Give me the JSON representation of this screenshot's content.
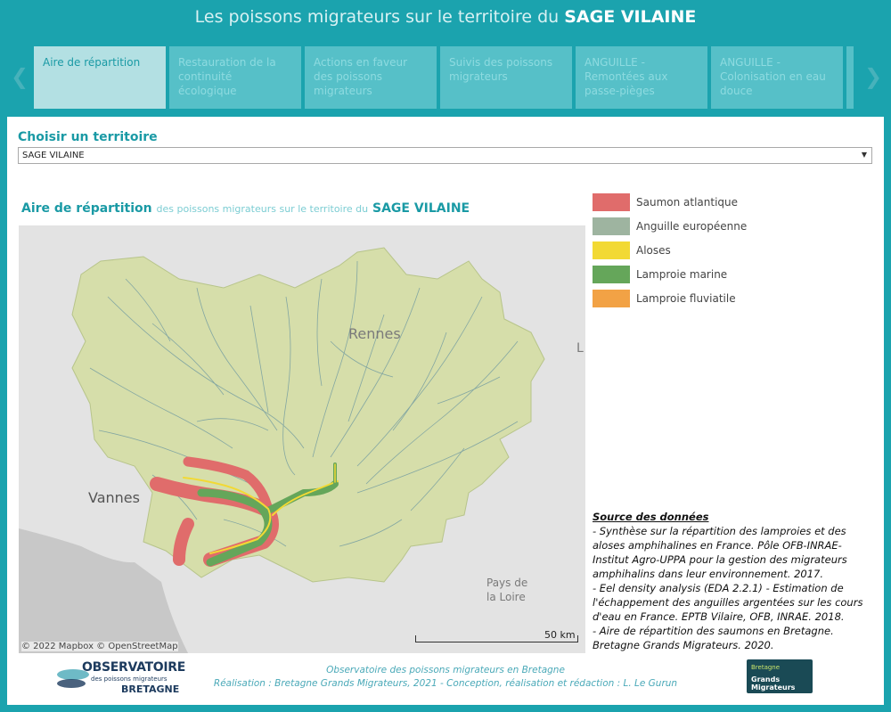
{
  "header": {
    "title_prefix": "Les poissons migrateurs sur le territoire du",
    "title_highlight": "SAGE VILAINE"
  },
  "tabs": [
    {
      "label": "Aire de répartition",
      "active": true
    },
    {
      "label": "Restauration de la continuité écologique",
      "active": false
    },
    {
      "label": "Actions en faveur des poissons migrateurs",
      "active": false
    },
    {
      "label": "Suivis des poissons migrateurs",
      "active": false
    },
    {
      "label": "ANGUILLE - Remontées aux passe-pièges",
      "active": false
    },
    {
      "label": "ANGUILLE - Colonisation en eau douce",
      "active": false
    }
  ],
  "icons": {
    "prev": "chevron-left-icon",
    "next": "chevron-right-icon",
    "caret": "dropdown-caret-icon"
  },
  "territory": {
    "label": "Choisir un territoire",
    "selected": "SAGE VILAINE",
    "caret": "▼"
  },
  "map_title": {
    "main": "Aire de répartition",
    "sub": "des poissons migrateurs sur le territoire du",
    "highlight": "SAGE VILAINE"
  },
  "map": {
    "labels": {
      "rennes": "Rennes",
      "vannes": "Vannes",
      "pays_loire_1": "Pays de",
      "pays_loire_2": "la Loire",
      "edge": "L"
    },
    "attribution": "© 2022 Mapbox  © OpenStreetMap",
    "scale": "50 km"
  },
  "legend": [
    {
      "label": "Saumon atlantique",
      "color": "#e06c6b"
    },
    {
      "label": "Anguille européenne",
      "color": "#9eb4a0"
    },
    {
      "label": "Aloses",
      "color": "#f2d934"
    },
    {
      "label": "Lamproie marine",
      "color": "#65a65a"
    },
    {
      "label": "Lamproie fluviatile",
      "color": "#f2a245"
    }
  ],
  "sources": {
    "heading": "Source des données",
    "items": [
      "- Synthèse sur la répartition des lamproies et des aloses amphihalines en France. Pôle OFB-INRAE-Institut Agro-UPPA pour la gestion des migrateurs amphihalins dans leur environnement. 2017.",
      "- Eel density analysis (EDA 2.2.1) - Estimation de l'échappement des anguilles argentées sur les cours d'eau en France. EPTB Vilaire, OFB, INRAE. 2018.",
      "- Aire de répartition des saumons en Bretagne. Bretagne Grands Migrateurs. 2020."
    ]
  },
  "footer": {
    "line1": "Observatoire des poissons migrateurs en Bretagne",
    "line2": "Réalisation : Bretagne Grands Migrateurs, 2021 - Conception, réalisation et rédaction : L. Le Gurun",
    "logo_left": {
      "big": "OBSERVATOIRE",
      "small": "des poissons migrateurs",
      "region": "BRETAGNE"
    },
    "logo_right": {
      "l1": "Bretagne",
      "l2": "Grands Migrateurs"
    }
  },
  "colors": {
    "accent": "#1ba3ae",
    "title_blue": "#1a9aa5",
    "map_land": "#d6deaa",
    "river": "#6f99a0"
  }
}
